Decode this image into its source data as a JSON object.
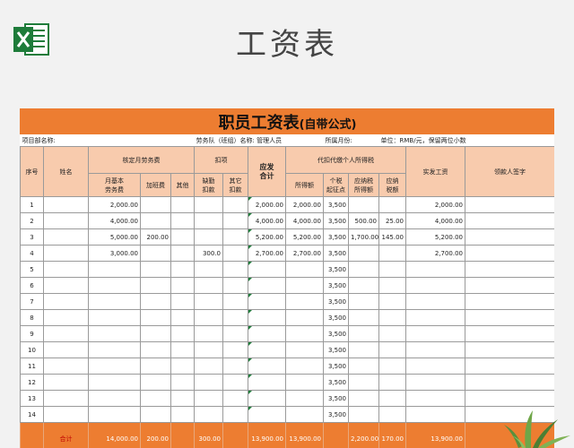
{
  "page_title": "工资表",
  "sheet_title": "职员工资表",
  "sheet_title_suffix": "(自带公式)",
  "info": {
    "project": "项目部名称:",
    "team": "劳务队（班组）名称:  管理人员",
    "month": "所属月份:",
    "unit": "单位：RMB/元，保留两位小数"
  },
  "headers": {
    "seq": "序号",
    "name": "姓名",
    "approved_fee": "核定月劳务费",
    "base_line1": "月基本",
    "base_line2": "劳务费",
    "overtime": "加班费",
    "other": "其他",
    "deduction": "扣项",
    "absence_line1": "缺勤",
    "absence_line2": "扣款",
    "other_ded_line1": "其它",
    "other_ded_line2": "扣款",
    "payable_line1": "应发",
    "payable_line2": "合计",
    "tax_group": "代扣代缴个人所得税",
    "income": "所得额",
    "threshold_line1": "个税",
    "threshold_line2": "起征点",
    "taxable_line1": "应纳税",
    "taxable_line2": "所得额",
    "tax_line1": "应纳",
    "tax_line2": "税额",
    "net_pay": "实发工资",
    "signature": "领款人签字"
  },
  "rows": [
    {
      "seq": "1",
      "base": "2,000.00",
      "overtime": "",
      "absence": "",
      "payable": "2,000.00",
      "income": "2,000.00",
      "threshold": "3,500",
      "taxable": "",
      "tax": "",
      "net": "2,000.00"
    },
    {
      "seq": "2",
      "base": "4,000.00",
      "overtime": "",
      "absence": "",
      "payable": "4,000.00",
      "income": "4,000.00",
      "threshold": "3,500",
      "taxable": "500.00",
      "tax": "25.00",
      "net": "4,000.00"
    },
    {
      "seq": "3",
      "base": "5,000.00",
      "overtime": "200.00",
      "absence": "",
      "payable": "5,200.00",
      "income": "5,200.00",
      "threshold": "3,500",
      "taxable": "1,700.00",
      "tax": "145.00",
      "net": "5,200.00"
    },
    {
      "seq": "4",
      "base": "3,000.00",
      "overtime": "",
      "absence": "300.0",
      "payable": "2,700.00",
      "income": "2,700.00",
      "threshold": "3,500",
      "taxable": "",
      "tax": "",
      "net": "2,700.00"
    },
    {
      "seq": "5",
      "base": "",
      "overtime": "",
      "absence": "",
      "payable": "",
      "income": "",
      "threshold": "3,500",
      "taxable": "",
      "tax": "",
      "net": ""
    },
    {
      "seq": "6",
      "base": "",
      "overtime": "",
      "absence": "",
      "payable": "",
      "income": "",
      "threshold": "3,500",
      "taxable": "",
      "tax": "",
      "net": ""
    },
    {
      "seq": "7",
      "base": "",
      "overtime": "",
      "absence": "",
      "payable": "",
      "income": "",
      "threshold": "3,500",
      "taxable": "",
      "tax": "",
      "net": ""
    },
    {
      "seq": "8",
      "base": "",
      "overtime": "",
      "absence": "",
      "payable": "",
      "income": "",
      "threshold": "3,500",
      "taxable": "",
      "tax": "",
      "net": ""
    },
    {
      "seq": "9",
      "base": "",
      "overtime": "",
      "absence": "",
      "payable": "",
      "income": "",
      "threshold": "3,500",
      "taxable": "",
      "tax": "",
      "net": ""
    },
    {
      "seq": "10",
      "base": "",
      "overtime": "",
      "absence": "",
      "payable": "",
      "income": "",
      "threshold": "3,500",
      "taxable": "",
      "tax": "",
      "net": ""
    },
    {
      "seq": "11",
      "base": "",
      "overtime": "",
      "absence": "",
      "payable": "",
      "income": "",
      "threshold": "3,500",
      "taxable": "",
      "tax": "",
      "net": ""
    },
    {
      "seq": "12",
      "base": "",
      "overtime": "",
      "absence": "",
      "payable": "",
      "income": "",
      "threshold": "3,500",
      "taxable": "",
      "tax": "",
      "net": ""
    },
    {
      "seq": "13",
      "base": "",
      "overtime": "",
      "absence": "",
      "payable": "",
      "income": "",
      "threshold": "3,500",
      "taxable": "",
      "tax": "",
      "net": ""
    },
    {
      "seq": "14",
      "base": "",
      "overtime": "",
      "absence": "",
      "payable": "",
      "income": "",
      "threshold": "3,500",
      "taxable": "",
      "tax": "",
      "net": ""
    }
  ],
  "totals": {
    "label": "合计",
    "base": "14,000.00",
    "overtime": "200.00",
    "absence": "300.00",
    "payable": "13,900.00",
    "income": "13,900.00",
    "taxable": "2,200.00",
    "tax": "170.00",
    "net": "13,900.00"
  },
  "icons": {
    "logo": "excel-logo-icon",
    "decor": "plant-icon"
  },
  "colors": {
    "accent": "#ed7d31",
    "header_fill": "#f8cbad",
    "excel_green": "#1e7c3a"
  }
}
